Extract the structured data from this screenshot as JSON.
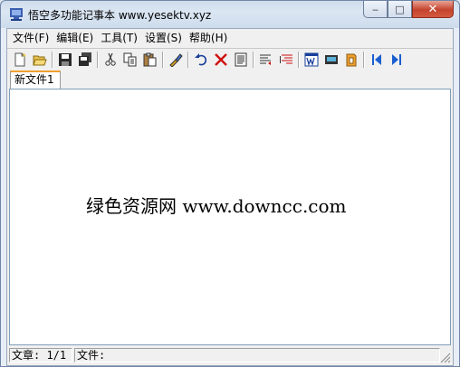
{
  "window": {
    "title": "悟空多功能记事本 www.yesektv.xyz",
    "minimize_glyph": "‒",
    "maximize_glyph": "□",
    "close_glyph": "✕"
  },
  "menu": {
    "items": [
      {
        "label": "文件(F)"
      },
      {
        "label": "编辑(E)"
      },
      {
        "label": "工具(T)"
      },
      {
        "label": "设置(S)"
      },
      {
        "label": "帮助(H)"
      }
    ]
  },
  "toolbar": {
    "groups": [
      [
        "new-file-icon",
        "open-folder-icon"
      ],
      [
        "save-icon",
        "save-all-icon"
      ],
      [
        "cut-icon",
        "copy-icon",
        "paste-icon"
      ],
      [
        "format-icon"
      ],
      [
        "undo-icon",
        "delete-icon",
        "document-icon"
      ],
      [
        "wrap-left-icon",
        "wrap-right-icon"
      ],
      [
        "word-icon",
        "keyboard-icon",
        "clip-icon"
      ],
      [
        "first-icon",
        "last-icon"
      ]
    ]
  },
  "tabs": [
    {
      "label": "新文件1",
      "active": true
    }
  ],
  "editor": {
    "content": "绿色资源网 www.downcc.com"
  },
  "status": {
    "article": "文章: 1/1",
    "file": "文件:"
  },
  "colors": {
    "tab_accent": "#f0a030",
    "close_button": "#c4442d",
    "toolbar_blue": "#1a5fd0"
  }
}
